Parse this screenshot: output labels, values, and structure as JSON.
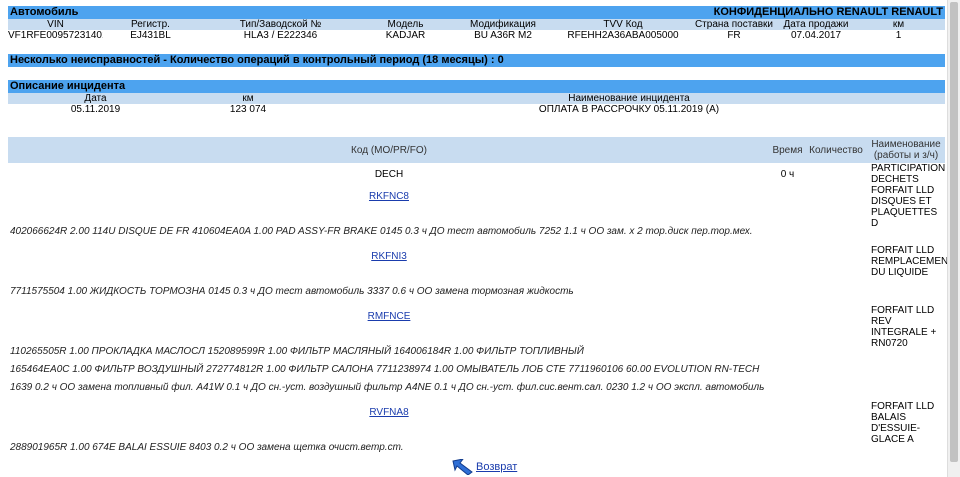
{
  "vehicle": {
    "section_title": "Автомобиль",
    "confidential": "КОНФИДЕНЦИАЛЬНО RENAULT RENAULT",
    "columns": [
      "VIN",
      "Регистр.",
      "Тип/Заводской №",
      "Модель",
      "Модификация",
      "TVV Код",
      "Страна поставки",
      "Дата продажи",
      "км"
    ],
    "values": [
      "VF1RFE00957231401",
      "EJ431BL",
      "HLA3 / E222346",
      "KADJAR",
      "BU A36R M2",
      "RFEHH2A36ABA005000",
      "FR",
      "07.04.2017",
      "1"
    ]
  },
  "faults_title": "Несколько неисправностей - Количество операций в контрольный период (18 месяцы) : 0",
  "incident": {
    "section_title": "Описание инцидента",
    "columns": [
      "Дата",
      "км",
      "Наименование инцидента"
    ],
    "values": [
      "05.11.2019",
      "123 074",
      "ОПЛАТА В РАССРОЧКУ 05.11.2019 (A)"
    ]
  },
  "ops_table": {
    "headers": {
      "code": "Код (MO/PR/FO)",
      "time": "Время",
      "qty": "Количество",
      "name": "Наименование (работы и з/ч)"
    },
    "rows": [
      {
        "code": "DECH",
        "link": false,
        "time": "0 ч",
        "name": "PARTICIPATION DECHETS",
        "details": []
      },
      {
        "code": "RKFNC8",
        "link": true,
        "time": "",
        "name": "FORFAIT LLD DISQUES ET PLAQUETTES D",
        "details": [
          "402066624R  2.00  114U DISQUE DE FR  410604EA0A  1.00  PAD ASSY-FR BRAKE  0145 0.3 ч  ДО тест автомобиль  7252 1.1 ч  ОО зам. x 2 тор.диск пер.тор.мех."
        ]
      },
      {
        "code": "RKFNI3",
        "link": true,
        "time": "",
        "name": "FORFAIT LLD REMPLACEMENT DU LIQUIDE",
        "details": [
          "7711575504  1.00  ЖИДКОСТЬ ТОРМОЗНА  0145 0.3 ч  ДО тест автомобиль  3337 0.6 ч  ОО замена тормозная жидкость"
        ]
      },
      {
        "code": "RMFNCE",
        "link": true,
        "time": "",
        "name": "FORFAIT LLD REV INTEGRALE + RN0720",
        "details": [
          "110265505R  1.00  ПРОКЛАДКА МАСЛОСЛ  152089599R  1.00  ФИЛЬТР МАСЛЯНЫЙ  164006184R  1.00  ФИЛЬТР ТОПЛИВНЫЙ",
          "165464EA0C  1.00  ФИЛЬТР ВОЗДУШНЫЙ  272774812R  1.00  ФИЛЬТР САЛОНА  7711238974  1.00  ОМЫВАТЕЛЬ ЛОБ СТЕ  7711960106  60.00  EVOLUTION RN-TECH",
          "1639 0.2 ч   ОО замена топливный фил.  A41W 0.1 ч  ДО сн.-уст. воздушный фильтр  A4NE 0.1 ч  ДО сн.-уст. фил.сис.вент.сал.  0230 1.2 ч  ОО экспл. автомобиль"
        ]
      },
      {
        "code": "RVFNA8",
        "link": true,
        "time": "",
        "name": "FORFAIT LLD BALAIS D'ESSUIE-GLACE A",
        "details": [
          "288901965R  1.00  674E BALAI ESSUIE  8403 0.2 ч  ОО замена щетка очист.ветр.ст."
        ]
      }
    ]
  },
  "back_link": "Возврат",
  "icons": {
    "back": "back-arrow-icon"
  }
}
